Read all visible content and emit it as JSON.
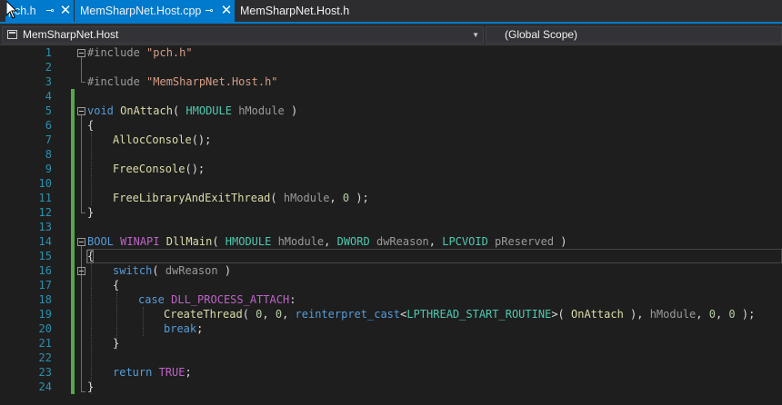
{
  "tabs": [
    {
      "label": "pch.h",
      "pin_icon": "⊸",
      "close_icon": "✕"
    },
    {
      "label": "MemSharpNet.Host.cpp",
      "pin_icon": "⊸",
      "close_icon": "✕"
    },
    {
      "label": "MemSharpNet.Host.h"
    }
  ],
  "nav": {
    "project": "MemSharpNet.Host",
    "scope": "(Global Scope)",
    "dropdown_icon": "▼"
  },
  "colors": {
    "accent": "#007acc",
    "line_number": "#2b91af",
    "keyword": "#569cd6",
    "type": "#4ec9b0",
    "function": "#dcdcaa",
    "macro": "#bd63c5",
    "string": "#d69d85",
    "change_bar": "#57a64a"
  },
  "line_numbers": [
    "1",
    "2",
    "3",
    "4",
    "5",
    "6",
    "7",
    "8",
    "9",
    "10",
    "11",
    "12",
    "13",
    "14",
    "15",
    "16",
    "17",
    "18",
    "19",
    "20",
    "21",
    "22",
    "23",
    "24"
  ],
  "code": {
    "l1": {
      "pp": "#include ",
      "str": "\"pch.h\""
    },
    "l3": {
      "pp": "#include ",
      "str": "\"MemSharpNet.Host.h\""
    },
    "l5": {
      "kw": "void",
      "fn": "OnAttach",
      "p1": "( ",
      "ty": "HMODULE",
      "param": "hModule",
      "p2": " )"
    },
    "l6": "{",
    "l7": {
      "fn": "AllocConsole",
      "rest": "();"
    },
    "l9": {
      "fn": "FreeConsole",
      "rest": "();"
    },
    "l11": {
      "fn": "FreeLibraryAndExitThread",
      "p1": "( ",
      "param": "hModule",
      "p2": ", ",
      "num": "0",
      "p3": " );"
    },
    "l12": "}",
    "l14": {
      "ty1": "BOOL",
      "mc": "WINAPI",
      "fn": "DllMain",
      "p1": "( ",
      "ty2": "HMODULE",
      "a1": "hModule",
      "c1": ", ",
      "ty3": "DWORD",
      "a2": "dwReason",
      "c2": ", ",
      "ty4": "LPCVOID",
      "a3": "pReserved",
      "p2": " )"
    },
    "l15": "{",
    "l16": {
      "kw": "switch",
      "p1": "( ",
      "param": "dwReason",
      "p2": " )"
    },
    "l17": "{",
    "l18": {
      "kw": "case",
      "mc": "DLL_PROCESS_ATTACH",
      "colon": ":"
    },
    "l19": {
      "fn": "CreateThread",
      "p1": "( ",
      "n1": "0",
      "c1": ", ",
      "n2": "0",
      "c2": ", ",
      "kw": "reinterpret_cast",
      "lt": "<",
      "ty": "LPTHREAD_START_ROUTINE",
      "gt": ">",
      "p2": "( ",
      "fn2": "OnAttach",
      "p3": " ), ",
      "param": "hModule",
      "c3": ", ",
      "n3": "0",
      "c4": ", ",
      "n4": "0",
      "p4": " );"
    },
    "l20": {
      "kw": "break",
      "semi": ";"
    },
    "l21": "}",
    "l23": {
      "kw": "return",
      "mc": "TRUE",
      "semi": ";"
    },
    "l24": "}"
  }
}
